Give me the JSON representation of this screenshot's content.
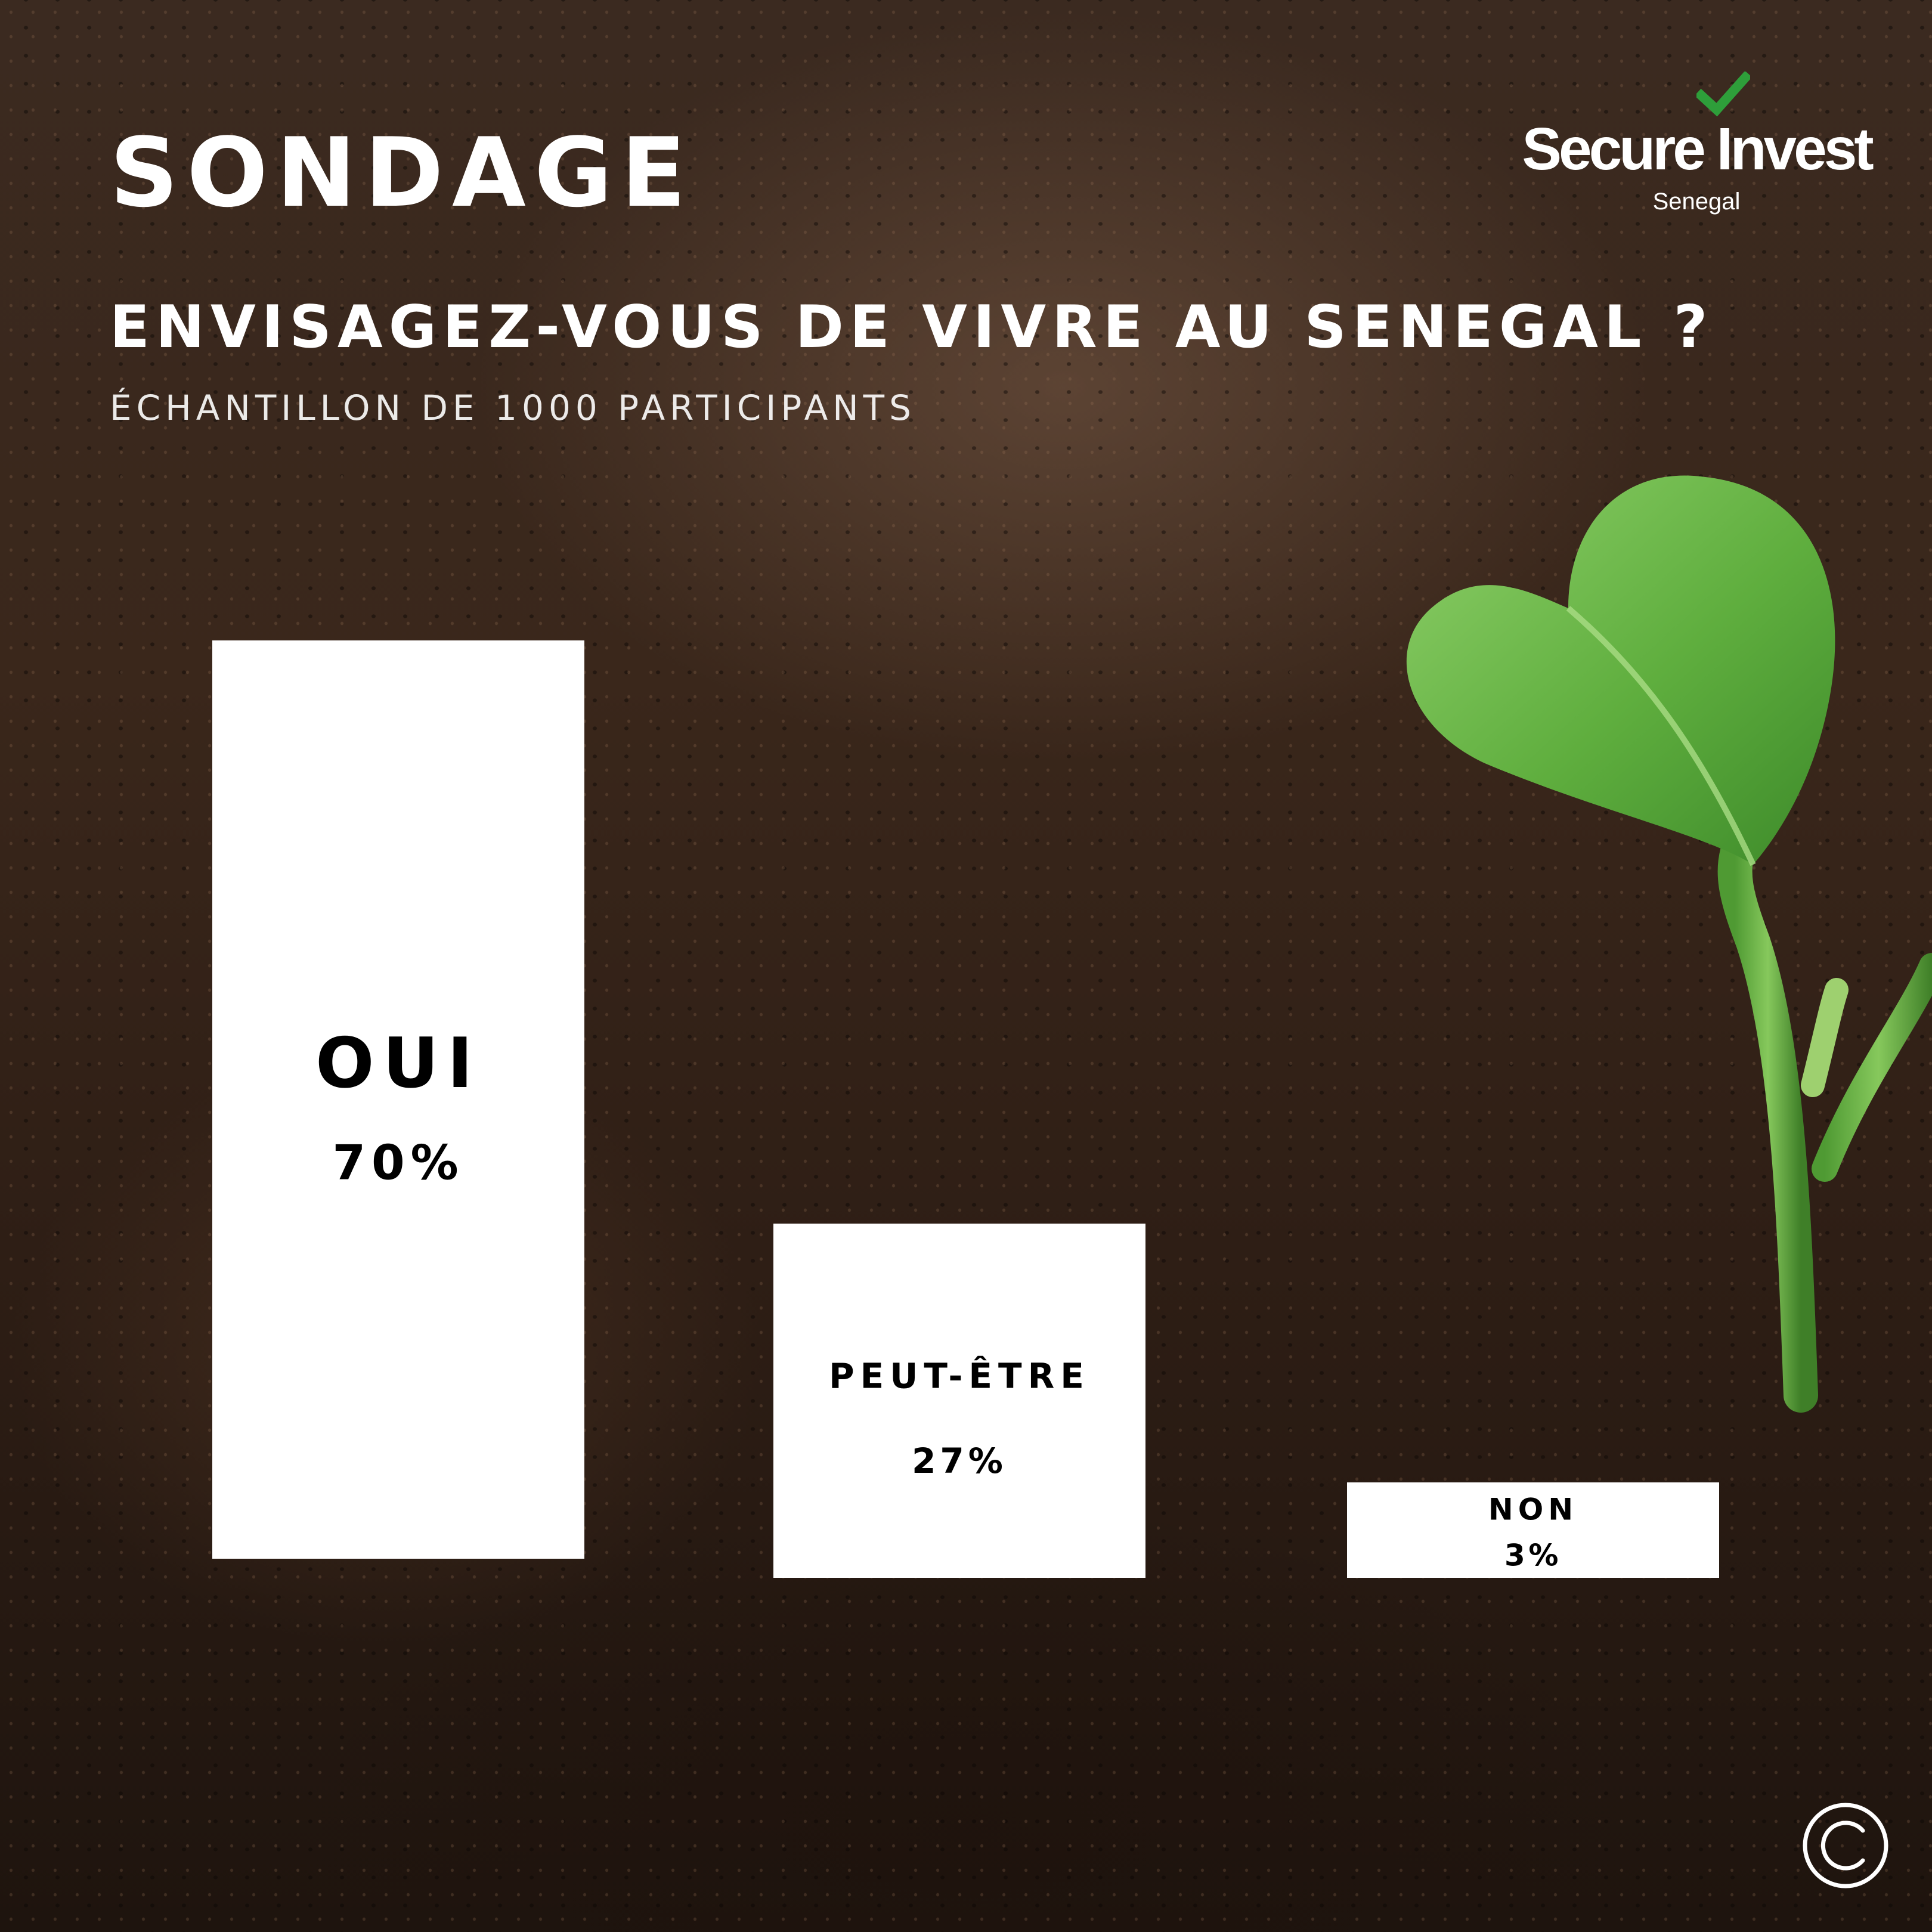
{
  "header": {
    "title": "SONDAGE",
    "question": "ENVISAGEZ-VOUS DE VIVRE AU SENEGAL ?",
    "subtitle": "ÉCHANTILLON DE 1000 PARTICIPANTS"
  },
  "logo": {
    "name": "Secure Invest",
    "country": "Senegal",
    "check_color": "#2e9e3a"
  },
  "colors": {
    "bar": "#ffffff",
    "label": "#000000",
    "leaf": "#6cb84a"
  },
  "chart_data": {
    "type": "bar",
    "categories": [
      "OUI",
      "PEUT-ÊTRE",
      "NON"
    ],
    "values": [
      70,
      27,
      3
    ],
    "value_labels": [
      "70%",
      "27%",
      "3%"
    ],
    "title": "ENVISAGEZ-VOUS DE VIVRE AU SENEGAL ?",
    "subtitle": "ÉCHANTILLON DE 1000 PARTICIPANTS",
    "value_unit": "%",
    "grid": false,
    "legend": "none"
  },
  "footer": {
    "copyright_icon": "copyright-icon"
  }
}
